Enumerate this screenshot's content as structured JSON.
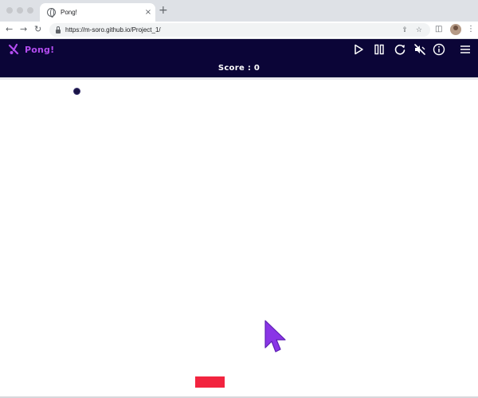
{
  "browser": {
    "tab_title": "Pong!",
    "tab_close": "×",
    "new_tab": "+",
    "url": "https://m-soro.github.io/Project_1/",
    "nav": {
      "back": "←",
      "forward": "→",
      "reload": "↻"
    },
    "icons": [
      "share-icon",
      "star-icon",
      "sidebar-icon",
      "profile-avatar"
    ]
  },
  "game": {
    "title": "Pong!",
    "score_label": "Score : 0",
    "controls": [
      "play-icon",
      "pause-icon",
      "restart-icon",
      "mute-icon",
      "info-icon",
      "menu-icon"
    ],
    "colors": {
      "header_bg": "#0b0537",
      "logo": "#b34cf0",
      "paddle": "#f2243f",
      "ball": "#1a1446",
      "cursor": "#8a35e6"
    }
  }
}
